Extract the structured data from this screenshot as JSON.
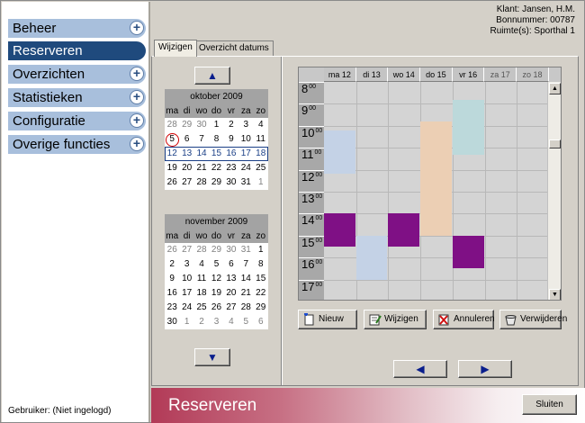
{
  "sidebar": {
    "items": [
      {
        "label": "Beheer"
      },
      {
        "label": "Reserveren"
      },
      {
        "label": "Overzichten"
      },
      {
        "label": "Statistieken"
      },
      {
        "label": "Configuratie"
      },
      {
        "label": "Overige functies"
      }
    ],
    "user_label": "Gebruiker: (Niet ingelogd)"
  },
  "header": {
    "client": "Klant: Jansen, H.M.",
    "bon": "Bonnummer: 00787",
    "room": "Ruimte(s): Sporthal 1"
  },
  "tabs": [
    {
      "label": "Wijzigen"
    },
    {
      "label": "Overzicht datums"
    }
  ],
  "calendar_oct": {
    "title": "oktober 2009",
    "dow": [
      "ma",
      "di",
      "wo",
      "do",
      "vr",
      "za",
      "zo"
    ],
    "weeks": [
      [
        "28",
        "29",
        "30",
        "1",
        "2",
        "3",
        "4"
      ],
      [
        "5",
        "6",
        "7",
        "8",
        "9",
        "10",
        "11"
      ],
      [
        "12",
        "13",
        "14",
        "15",
        "16",
        "17",
        "18"
      ],
      [
        "19",
        "20",
        "21",
        "22",
        "23",
        "24",
        "25"
      ],
      [
        "26",
        "27",
        "28",
        "29",
        "30",
        "31",
        "1"
      ]
    ]
  },
  "calendar_nov": {
    "title": "november 2009",
    "dow": [
      "ma",
      "di",
      "wo",
      "do",
      "vr",
      "za",
      "zo"
    ],
    "weeks": [
      [
        "26",
        "27",
        "28",
        "29",
        "30",
        "31",
        "1"
      ],
      [
        "2",
        "3",
        "4",
        "5",
        "6",
        "7",
        "8"
      ],
      [
        "9",
        "10",
        "11",
        "12",
        "13",
        "14",
        "15"
      ],
      [
        "16",
        "17",
        "18",
        "19",
        "20",
        "21",
        "22"
      ],
      [
        "23",
        "24",
        "25",
        "26",
        "27",
        "28",
        "29"
      ],
      [
        "30",
        "1",
        "2",
        "3",
        "4",
        "5",
        "6"
      ]
    ]
  },
  "schedule": {
    "days": [
      "ma 12",
      "di 13",
      "wo 14",
      "do 15",
      "vr 16",
      "za 17",
      "zo 18"
    ],
    "hours": [
      "8",
      "9",
      "10",
      "11",
      "12",
      "13",
      "14",
      "15",
      "16",
      "17"
    ],
    "minutes": "00",
    "events": [
      {
        "day": 0,
        "start": 10.2,
        "end": 12.2,
        "color": "#c4d2e6"
      },
      {
        "day": 0,
        "start": 14.0,
        "end": 15.5,
        "color": "#7f1085"
      },
      {
        "day": 1,
        "start": 15.0,
        "end": 17.0,
        "color": "#c4d2e6"
      },
      {
        "day": 2,
        "start": 14.0,
        "end": 15.5,
        "color": "#7f1085"
      },
      {
        "day": 3,
        "start": 9.8,
        "end": 15.0,
        "color": "#eccfb4"
      },
      {
        "day": 4,
        "start": 8.8,
        "end": 11.3,
        "color": "#bcd9db"
      },
      {
        "day": 4,
        "start": 15.0,
        "end": 16.5,
        "color": "#7f1085"
      }
    ]
  },
  "actions": {
    "new": "Nieuw",
    "edit": "Wijzigen",
    "cancel": "Annuleren",
    "delete": "Verwijderen"
  },
  "footer": {
    "title": "Reserveren",
    "close": "Sluiten"
  }
}
